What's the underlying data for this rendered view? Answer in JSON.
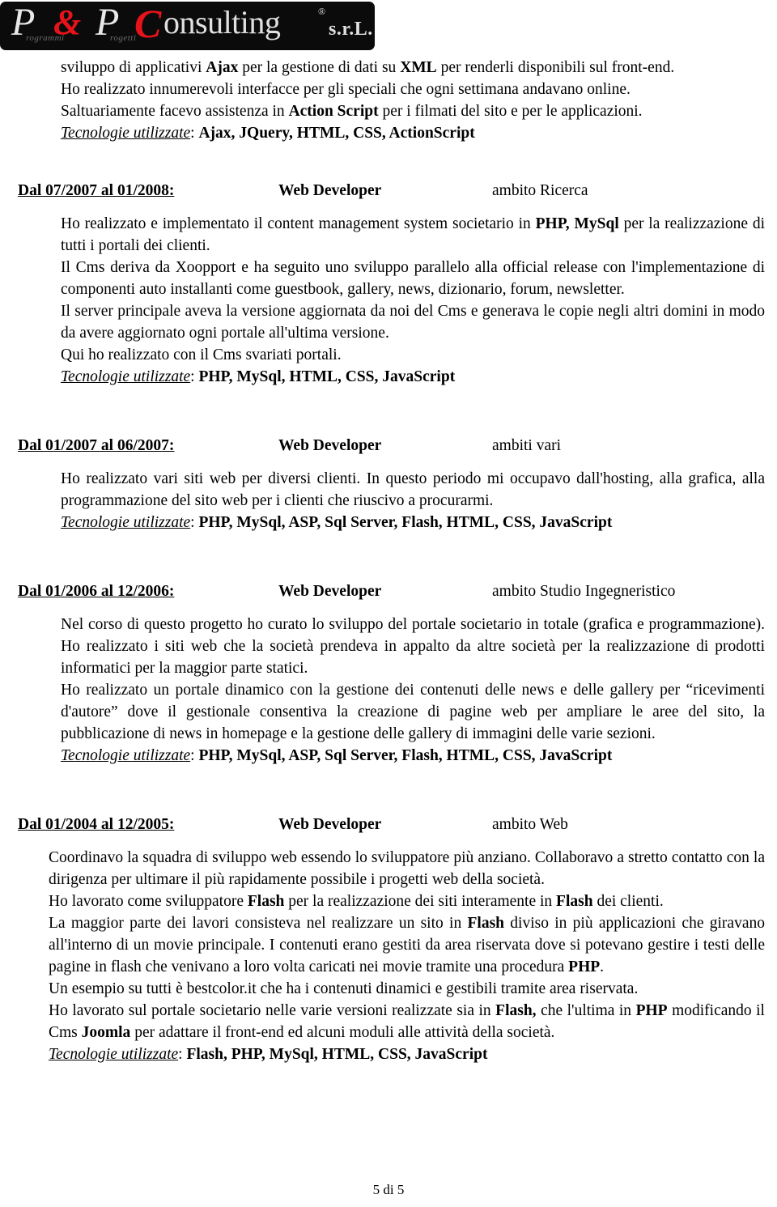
{
  "logo": {
    "part_p1": "P",
    "part_amp": "&",
    "part_p2": "P",
    "part_c": "C",
    "part_consulting": "onsulting",
    "registered_mark": "®",
    "part_srl": "s.r.L.",
    "sub_left": "rogrammi",
    "sub_right": "rogetti"
  },
  "intro": {
    "line1_a": "sviluppo di applicativi ",
    "line1_b": "Ajax",
    "line1_c": " per la gestione di dati su ",
    "line1_d": "XML",
    "line1_e": " per renderli disponibili sul front-end.",
    "line2": "Ho realizzato innumerevoli interfacce per gli speciali che ogni settimana andavano online.",
    "line3_a": "Saltuariamente facevo assistenza in ",
    "line3_b": "Action Script",
    "line3_c": " per i filmati del sito e per le applicazioni.",
    "tech_label": "Tecnologie utilizzate",
    "tech_sep": ": ",
    "tech_list": "Ajax, JQuery, HTML, CSS, ActionScript"
  },
  "jobs": [
    {
      "dates": "Dal 07/2007 al 01/2008:",
      "role": "Web Developer",
      "scope": "ambito Ricerca",
      "p1_a": "Ho realizzato e implementato il content management system societario in ",
      "p1_b": "PHP, MySql",
      "p1_c": " per la realizzazione di tutti i portali dei clienti.",
      "p2": "Il Cms deriva da Xoopport e ha seguito uno sviluppo parallelo alla official release con l'implementazione di componenti auto installanti come guestbook, gallery, news, dizionario, forum, newsletter.",
      "p3": "Il server principale aveva la versione aggiornata da noi del Cms e generava le copie negli altri domini in modo da avere aggiornato ogni portale all'ultima versione.",
      "p4": "Qui ho realizzato con il Cms svariati portali.",
      "tech_label": "Tecnologie utilizzate",
      "tech_sep": ": ",
      "tech_list": "PHP, MySql, HTML, CSS, JavaScript"
    },
    {
      "dates": "Dal 01/2007 al 06/2007:",
      "role": "Web Developer",
      "scope": "ambiti vari",
      "p1": "Ho realizzato vari siti web per diversi clienti. In questo periodo mi occupavo dall'hosting, alla grafica, alla programmazione del sito web per i clienti che riuscivo a procurarmi.",
      "tech_label": "Tecnologie utilizzate",
      "tech_sep": ": ",
      "tech_list": "PHP, MySql, ASP, Sql Server, Flash, HTML, CSS, JavaScript"
    },
    {
      "dates": "Dal 01/2006 al 12/2006:",
      "role": "Web Developer",
      "scope": "ambito Studio Ingegneristico",
      "p1": "Nel corso di questo progetto ho curato lo sviluppo del portale societario in totale (grafica e programmazione). Ho realizzato i siti web che la società prendeva in appalto da altre società per la realizzazione di prodotti informatici per la maggior parte statici.",
      "p2": "Ho realizzato un portale dinamico con la gestione dei contenuti delle news e delle gallery per “ricevimenti d'autore” dove il gestionale consentiva la creazione di pagine web per ampliare le aree del sito, la pubblicazione di news in homepage e la gestione delle gallery di immagini delle varie sezioni.",
      "tech_label": "Tecnologie utilizzate",
      "tech_sep": ": ",
      "tech_list": "PHP, MySql,  ASP, Sql Server, Flash,  HTML, CSS, JavaScript"
    },
    {
      "dates": "Dal 01/2004 al 12/2005:",
      "role": "Web Developer",
      "scope": "ambito Web",
      "p1": "Coordinavo la squadra di sviluppo web essendo lo sviluppatore più anziano. Collaboravo a stretto contatto con la dirigenza per ultimare il più rapidamente possibile i progetti web della società.",
      "p2_a": "Ho lavorato come sviluppatore ",
      "p2_b": "Flash",
      "p2_c": " per la realizzazione dei siti interamente in ",
      "p2_d": "Flash",
      "p2_e": " dei clienti.",
      "p3_a": "La maggior parte dei lavori consisteva nel realizzare un sito in ",
      "p3_b": "Flash",
      "p3_c": " diviso in più applicazioni che giravano all'interno di un movie principale. I contenuti erano gestiti da area riservata dove si potevano gestire i testi delle pagine in flash che venivano a loro volta caricati nei movie tramite una procedura ",
      "p3_d": "PHP",
      "p3_e": ".",
      "p4": "Un esempio su tutti è bestcolor.it che ha i contenuti dinamici e gestibili tramite area riservata.",
      "p5_a": "Ho lavorato sul portale societario nelle varie versioni realizzate sia in ",
      "p5_b": "Flash,",
      "p5_c": " che l'ultima in ",
      "p5_d": "PHP",
      "p5_e": " modificando il Cms ",
      "p5_f": "Joomla",
      "p5_g": " per adattare il front-end ed alcuni moduli alle attività della società.",
      "tech_label": "Tecnologie utilizzate",
      "tech_sep": ": ",
      "tech_list": "Flash, PHP, MySql, HTML, CSS, JavaScript"
    }
  ],
  "footer": {
    "page_number": "5 di 5"
  }
}
